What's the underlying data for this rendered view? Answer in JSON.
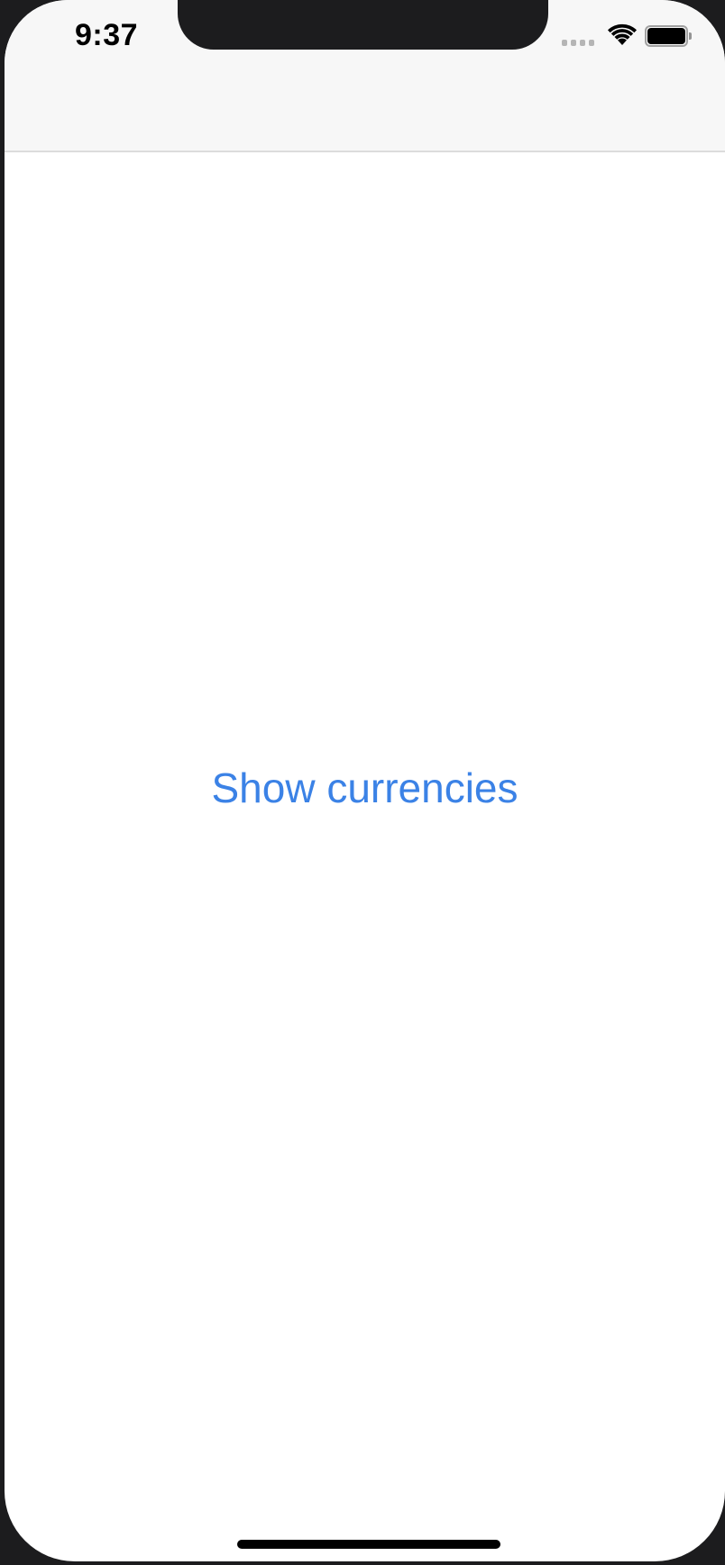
{
  "status_bar": {
    "time": "9:37",
    "icons": [
      "cellular-signal-icon",
      "wifi-icon",
      "battery-icon"
    ]
  },
  "main": {
    "show_currencies_label": "Show currencies"
  },
  "colors": {
    "accent": "#3b82e6",
    "nav_bar_background": "#f7f7f7",
    "screen_background": "#ffffff",
    "device_frame": "#1c1c1e"
  }
}
